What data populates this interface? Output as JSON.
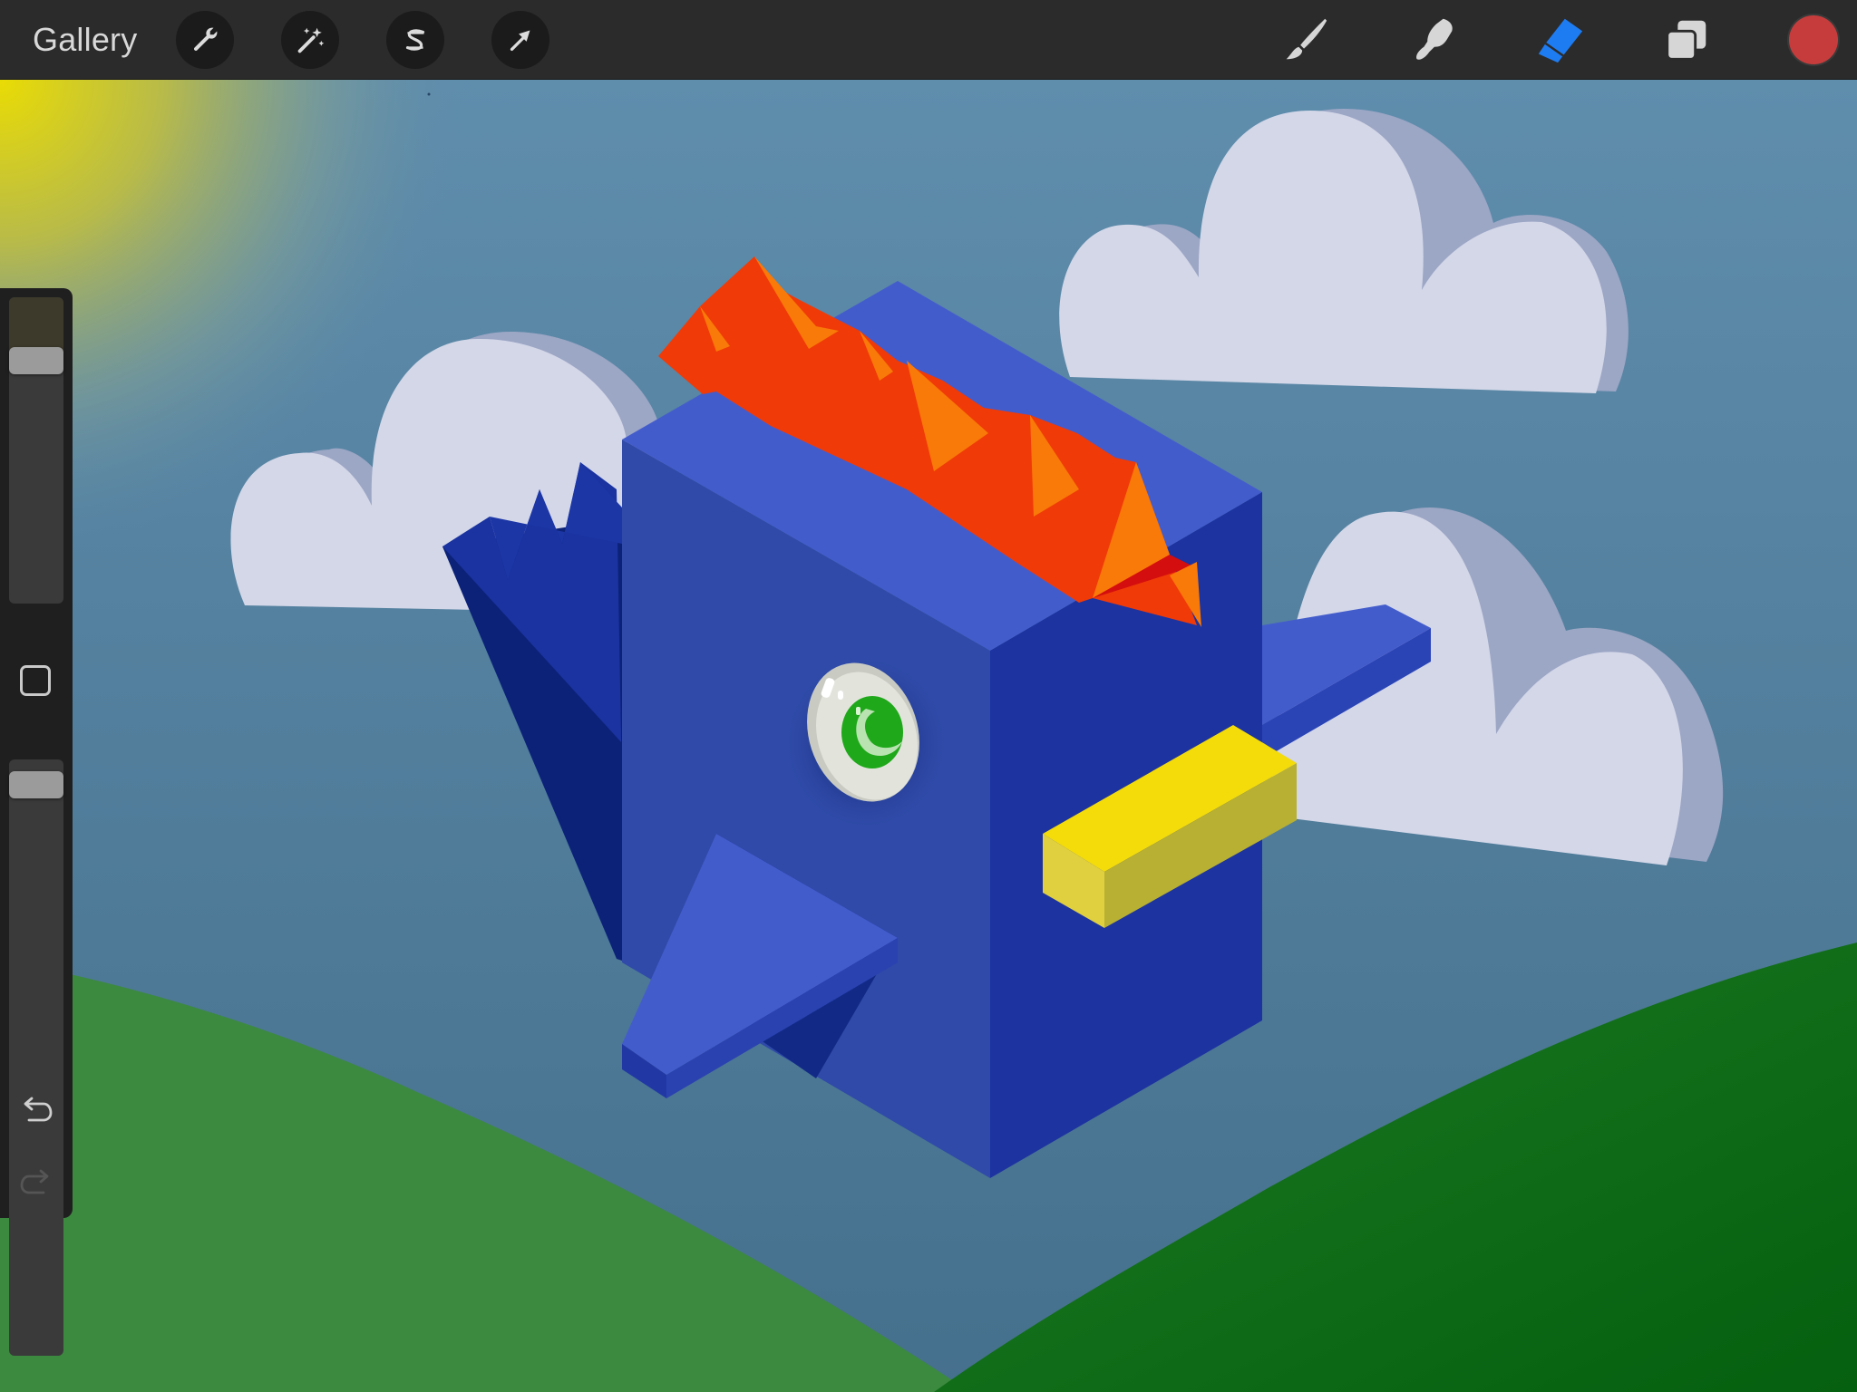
{
  "app": {
    "gallery_label": "Gallery"
  },
  "toolbar": {
    "left_tools": [
      {
        "name": "actions",
        "icon": "wrench-icon"
      },
      {
        "name": "adjustments",
        "icon": "magic-wand-icon"
      },
      {
        "name": "selection",
        "icon": "selection-s-icon"
      },
      {
        "name": "transform",
        "icon": "arrow-cursor-icon"
      }
    ],
    "right_tools": [
      {
        "name": "brush",
        "icon": "brush-icon",
        "active": false
      },
      {
        "name": "smudge",
        "icon": "smudge-icon",
        "active": false
      },
      {
        "name": "eraser",
        "icon": "eraser-icon",
        "active": true
      },
      {
        "name": "layers",
        "icon": "layers-icon",
        "active": false
      }
    ],
    "current_color": "#c63c3c",
    "active_tool_color": "#1e7cf2"
  },
  "sidebar": {
    "brush_size_level": 0.82,
    "opacity_level": 0.98,
    "modify_button_icon": "square-icon",
    "undo_icon": "undo-icon",
    "redo_icon": "redo-icon",
    "redo_enabled": false
  },
  "artwork": {
    "sky_color": "#5c8aa9",
    "sun_glow_color": "#e9dc05",
    "bird_body_color": "#2f4aa8",
    "bird_top_color": "#435ccc",
    "bird_side_color": "#1c33a0",
    "comb_color": "#f03a08",
    "comb_highlight_color": "#f97a08",
    "beak_color": "#f4dc0a",
    "eye_iris_color": "#1fa81a",
    "cloud_color": "#d3d7e8",
    "cloud_shade_color": "#9ca6c5",
    "hill_left_color": "#3c8a40",
    "hill_right_color": "#0b6b14"
  }
}
